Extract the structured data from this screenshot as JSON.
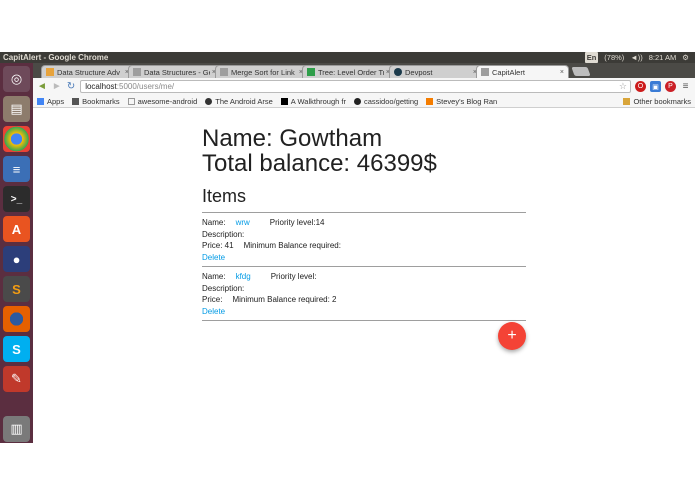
{
  "window": {
    "title": "CapitAlert - Google Chrome"
  },
  "tray": {
    "lang": "En",
    "battery": "(78%)",
    "volume": "◄))",
    "time": "8:21 AM",
    "settings": "⚙"
  },
  "tabs": [
    {
      "title": "Data Structure Adv",
      "close": "×",
      "color": "#e7a33c"
    },
    {
      "title": "Data Structures - Ge",
      "close": "×",
      "color": "#9e9e9e"
    },
    {
      "title": "Merge Sort for Link",
      "close": "×",
      "color": "#9e9e9e"
    },
    {
      "title": "Tree: Level Order Tr",
      "close": "×",
      "color": "#2e9e4a"
    },
    {
      "title": "Devpost",
      "close": "×",
      "color": "#1b3a4b"
    },
    {
      "title": "CapitAlert",
      "close": "×",
      "color": "#9e9e9e"
    }
  ],
  "toolbar": {
    "back": "◄",
    "forward": "►",
    "reload": "↻",
    "url_host": "localhost",
    "url_path": ":5000/users/me/",
    "star": "☆"
  },
  "bookmarks": {
    "apps": "Apps",
    "items": [
      "Bookmarks",
      "awesome-android",
      "The Android Arse",
      "A Walkthrough fr",
      "cassidoo/getting",
      "Stevey's Blog Ran"
    ],
    "other": "Other bookmarks"
  },
  "profile": {
    "name_line": "Name: Gowtham",
    "balance_line": "Total balance: 46399$"
  },
  "items_heading": "Items",
  "items": [
    {
      "name_label": "Name:",
      "name": "wrw",
      "priority": "Priority level:14",
      "description": "Description:",
      "price": "Price: 41",
      "min_balance": "Minimum Balance required:",
      "delete": "Delete"
    },
    {
      "name_label": "Name:",
      "name": "kfdg",
      "priority": "Priority level:",
      "description": "Description:",
      "price": "Price:",
      "min_balance": "Minimum Balance required: 2",
      "delete": "Delete"
    }
  ],
  "fab": {
    "label": "+"
  },
  "colors": {
    "accent_link": "#039be5",
    "fab": "#f44336",
    "launcher": "#5b2e40",
    "titlebar": "#3c3b37"
  }
}
